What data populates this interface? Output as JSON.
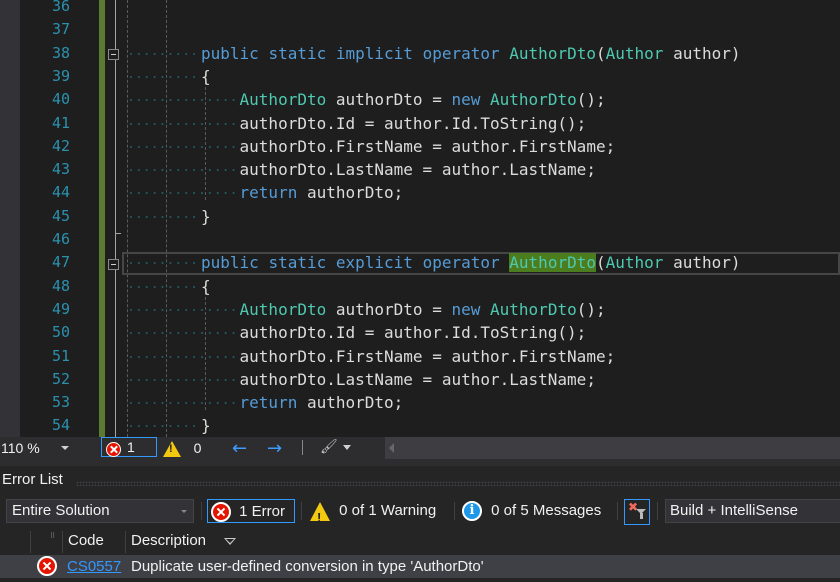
{
  "editor": {
    "lines": [
      {
        "num": "36"
      },
      {
        "num": "37"
      },
      {
        "num": "38",
        "tokens": [
          [
            "kw",
            "public"
          ],
          [
            "sp",
            " "
          ],
          [
            "kw",
            "static"
          ],
          [
            "sp",
            " "
          ],
          [
            "kw",
            "implicit"
          ],
          [
            "sp",
            " "
          ],
          [
            "kw",
            "operator"
          ],
          [
            "sp",
            " "
          ],
          [
            "ty",
            "AuthorDto"
          ],
          [
            "id",
            "("
          ],
          [
            "ty",
            "Author"
          ],
          [
            "sp",
            " "
          ],
          [
            "id",
            "author)"
          ]
        ]
      },
      {
        "num": "39",
        "tokens": [
          [
            "brace",
            "{"
          ]
        ]
      },
      {
        "num": "40",
        "tokens": [
          [
            "ty",
            "    AuthorDto"
          ],
          [
            "id",
            " authorDto = "
          ],
          [
            "kw",
            "new"
          ],
          [
            "sp",
            " "
          ],
          [
            "ty",
            "AuthorDto"
          ],
          [
            "id",
            "();"
          ]
        ]
      },
      {
        "num": "41",
        "tokens": [
          [
            "id",
            "    authorDto.Id = author.Id.ToString();"
          ]
        ]
      },
      {
        "num": "42",
        "tokens": [
          [
            "id",
            "    authorDto.FirstName = author.FirstName;"
          ]
        ]
      },
      {
        "num": "43",
        "tokens": [
          [
            "id",
            "    authorDto.LastName = author.LastName;"
          ]
        ]
      },
      {
        "num": "44",
        "tokens": [
          [
            "kw",
            "    return"
          ],
          [
            "id",
            " authorDto;"
          ]
        ]
      },
      {
        "num": "45",
        "tokens": [
          [
            "brace",
            "}"
          ]
        ]
      },
      {
        "num": "46"
      },
      {
        "num": "47",
        "tokens": [
          [
            "kw",
            "public"
          ],
          [
            "sp",
            " "
          ],
          [
            "kw",
            "static"
          ],
          [
            "sp",
            " "
          ],
          [
            "kw",
            "explicit"
          ],
          [
            "sp",
            " "
          ],
          [
            "kw",
            "operator"
          ],
          [
            "sp",
            " "
          ],
          [
            "hl",
            "AuthorDto"
          ],
          [
            "id",
            "("
          ],
          [
            "ty",
            "Author"
          ],
          [
            "sp",
            " "
          ],
          [
            "id",
            "author)"
          ]
        ]
      },
      {
        "num": "48",
        "tokens": [
          [
            "brace",
            "{"
          ]
        ]
      },
      {
        "num": "49",
        "tokens": [
          [
            "ty",
            "    AuthorDto"
          ],
          [
            "id",
            " authorDto = "
          ],
          [
            "kw",
            "new"
          ],
          [
            "sp",
            " "
          ],
          [
            "ty",
            "AuthorDto"
          ],
          [
            "id",
            "();"
          ]
        ]
      },
      {
        "num": "50",
        "tokens": [
          [
            "id",
            "    authorDto.Id = author.Id.ToString();"
          ]
        ]
      },
      {
        "num": "51",
        "tokens": [
          [
            "id",
            "    authorDto.FirstName = author.FirstName;"
          ]
        ]
      },
      {
        "num": "52",
        "tokens": [
          [
            "id",
            "    authorDto.LastName = author.LastName;"
          ]
        ]
      },
      {
        "num": "53",
        "tokens": [
          [
            "kw",
            "    return"
          ],
          [
            "id",
            " authorDto;"
          ]
        ]
      },
      {
        "num": "54",
        "tokens": [
          [
            "brace",
            "}"
          ]
        ]
      }
    ]
  },
  "statusbar": {
    "zoom": "110 %",
    "errors": "1",
    "warnings": "0",
    "back_icon": "arrow-left",
    "forward_icon": "arrow-right",
    "brush_glyph": "🖌"
  },
  "error_list": {
    "title": "Error List",
    "scope": "Entire Solution",
    "errors_label": "1 Error",
    "warnings_label": "0 of 1 Warning",
    "messages_label": "0 of 5 Messages",
    "info_glyph": "i",
    "filter_x_glyph": "✖",
    "source": "Build + IntelliSense",
    "columns": {
      "code": "Code",
      "description": "Description"
    },
    "pin_glyph": "⠿",
    "rows": [
      {
        "code": "CS0557",
        "description": "Duplicate user-defined conversion in type 'AuthorDto'"
      }
    ]
  },
  "colors": {
    "keyword": "#569cd6",
    "type": "#4ec9b0",
    "line_number": "#2b91af",
    "change_bar": "#5b7a32",
    "error_red": "#e51400",
    "selection_blue": "#3399ff"
  }
}
